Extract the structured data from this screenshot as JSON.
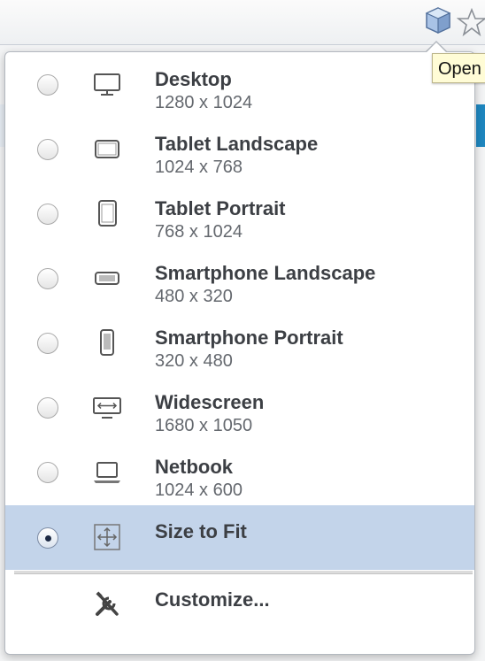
{
  "toolbar": {
    "extension_icon": "cube-icon",
    "bookmark_icon": "star-icon",
    "tooltip_text": "Open"
  },
  "menu": {
    "items": [
      {
        "title": "Desktop",
        "size": "1280 x 1024",
        "icon": "desktop-monitor-icon",
        "selected": false
      },
      {
        "title": "Tablet Landscape",
        "size": "1024 x 768",
        "icon": "tablet-landscape-icon",
        "selected": false
      },
      {
        "title": "Tablet Portrait",
        "size": "768 x 1024",
        "icon": "tablet-portrait-icon",
        "selected": false
      },
      {
        "title": "Smartphone Landscape",
        "size": "480 x 320",
        "icon": "smartphone-landscape-icon",
        "selected": false
      },
      {
        "title": "Smartphone Portrait",
        "size": "320 x 480",
        "icon": "smartphone-portrait-icon",
        "selected": false
      },
      {
        "title": "Widescreen",
        "size": "1680 x 1050",
        "icon": "widescreen-icon",
        "selected": false
      },
      {
        "title": "Netbook",
        "size": "1024 x 600",
        "icon": "netbook-laptop-icon",
        "selected": false
      },
      {
        "title": "Size to Fit",
        "size": "",
        "icon": "size-to-fit-icon",
        "selected": true
      }
    ],
    "customize_label": "Customize...",
    "customize_icon": "tools-icon"
  },
  "colors": {
    "selected_row": "#c3d4ea",
    "title_text": "#3c3f44",
    "subtitle_text": "#64686e",
    "tooltip_bg": "#fffcd6"
  }
}
